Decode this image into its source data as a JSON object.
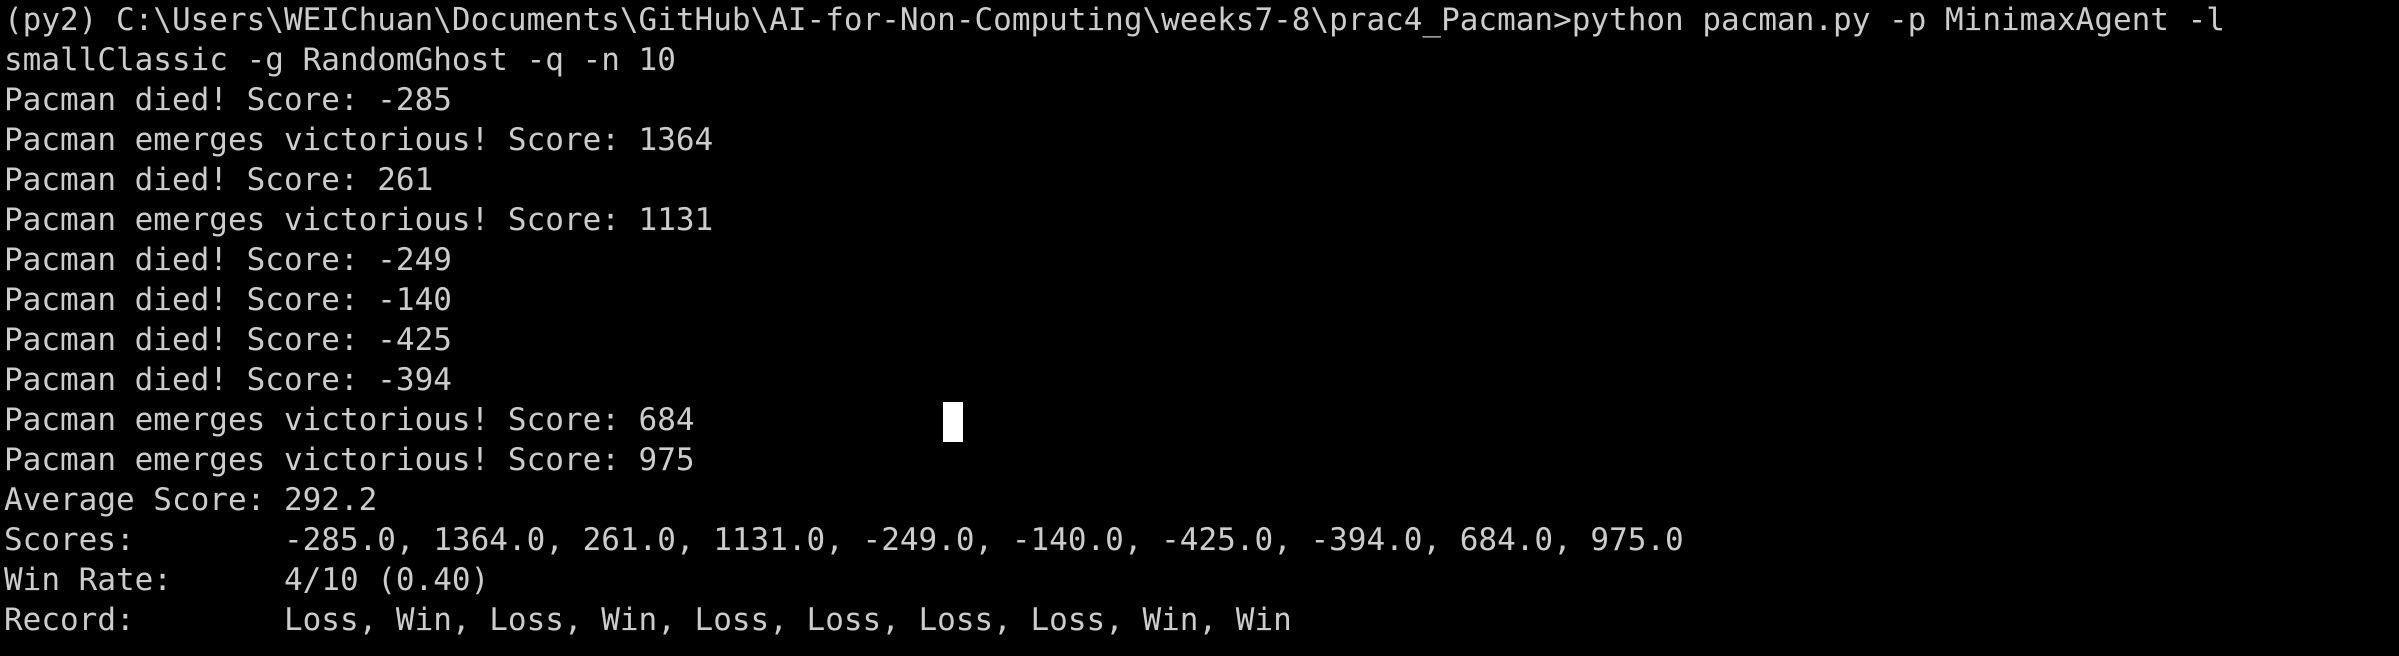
{
  "terminal": {
    "lines": [
      "(py2) C:\\Users\\WEIChuan\\Documents\\GitHub\\AI-for-Non-Computing\\weeks7-8\\prac4_Pacman>python pacman.py -p MinimaxAgent -l",
      "smallClassic -g RandomGhost -q -n 10",
      "Pacman died! Score: -285",
      "Pacman emerges victorious! Score: 1364",
      "Pacman died! Score: 261",
      "Pacman emerges victorious! Score: 1131",
      "Pacman died! Score: -249",
      "Pacman died! Score: -140",
      "Pacman died! Score: -425",
      "Pacman died! Score: -394",
      "Pacman emerges victorious! Score: 684",
      "Pacman emerges victorious! Score: 975",
      "Average Score: 292.2",
      "Scores:        -285.0, 1364.0, 261.0, 1131.0, -249.0, -140.0, -425.0, -394.0, 684.0, 975.0",
      "Win Rate:      4/10 (0.40)",
      "Record:        Loss, Win, Loss, Win, Loss, Loss, Loss, Loss, Win, Win"
    ]
  },
  "colors": {
    "background": "#000000",
    "text": "#cccccc",
    "cursor": "#ffffff"
  }
}
